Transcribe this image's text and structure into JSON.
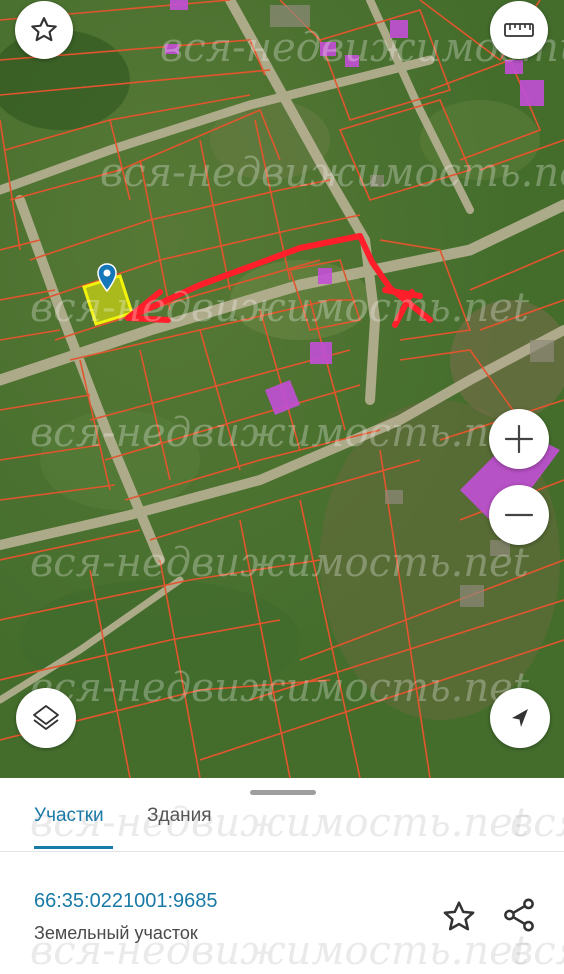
{
  "map": {
    "watermark_text": "вся-недвижимость.net",
    "parcel_line_color": "#e2552d",
    "selected_parcel_color": "#f2f20a",
    "building_color": "#c24fd6",
    "annotation_arrow_color": "#ff1e2a",
    "marker_color": "#1577b7",
    "icons": {
      "favorite": "star-outline-icon",
      "ruler": "ruler-icon",
      "zoom_in": "plus-icon",
      "zoom_out": "minus-icon",
      "layers": "layers-icon",
      "locate": "navigation-arrow-icon",
      "marker": "map-pin-icon"
    }
  },
  "panel": {
    "tabs": [
      {
        "label": "Участки",
        "active": true
      },
      {
        "label": "Здания",
        "active": false
      }
    ],
    "cadastral_number": "66:35:0221001:9685",
    "parcel_type": "Земельный участок",
    "accent_color": "#1a7aa7",
    "icons": {
      "favorite": "star-outline-icon",
      "share": "share-icon"
    }
  }
}
